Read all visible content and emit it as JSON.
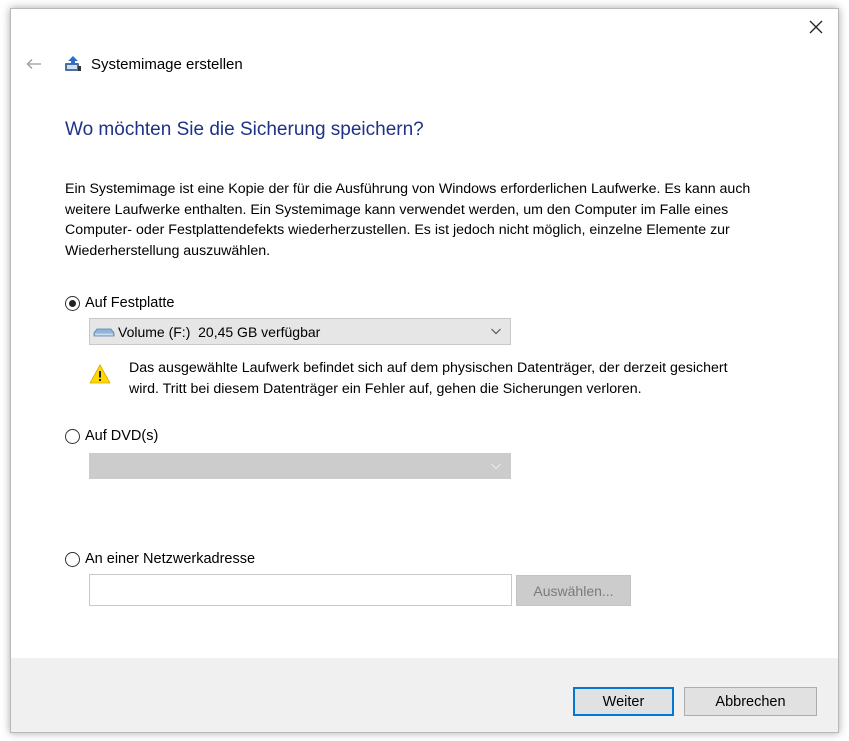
{
  "window": {
    "title": "Systemimage erstellen",
    "close_glyph": "✕"
  },
  "nav": {
    "back_icon": "back-arrow-icon",
    "app_icon": "system-image-icon"
  },
  "heading": "Wo möchten Sie die Sicherung speichern?",
  "description": "Ein Systemimage ist eine Kopie der für die Ausführung von Windows erforderlichen Laufwerke. Es kann auch weitere Laufwerke enthalten. Ein Systemimage kann verwendet werden, um den Computer im Falle eines Computer- oder Festplattendefekts wiederherzustellen. Es ist jedoch nicht möglich, einzelne Elemente zur Wiederherstellung auszuwählen.",
  "options": {
    "hard_disk": {
      "label": "Auf Festplatte",
      "selected": true,
      "dropdown_value": "Volume (F:)  20,45 GB verfügbar",
      "warning": "Das ausgewählte Laufwerk befindet sich auf dem physischen Datenträger, der derzeit gesichert wird. Tritt bei diesem Datenträger ein Fehler auf, gehen die Sicherungen verloren."
    },
    "dvd": {
      "label": "Auf DVD(s)",
      "selected": false,
      "dropdown_value": ""
    },
    "network": {
      "label": "An einer Netzwerkadresse",
      "selected": false,
      "input_value": "",
      "browse_label": "Auswählen..."
    }
  },
  "footer": {
    "next_label": "Weiter",
    "cancel_label": "Abbrechen"
  },
  "colors": {
    "heading": "#1e3287",
    "accent": "#0078d7",
    "warning": "#ffd800"
  }
}
